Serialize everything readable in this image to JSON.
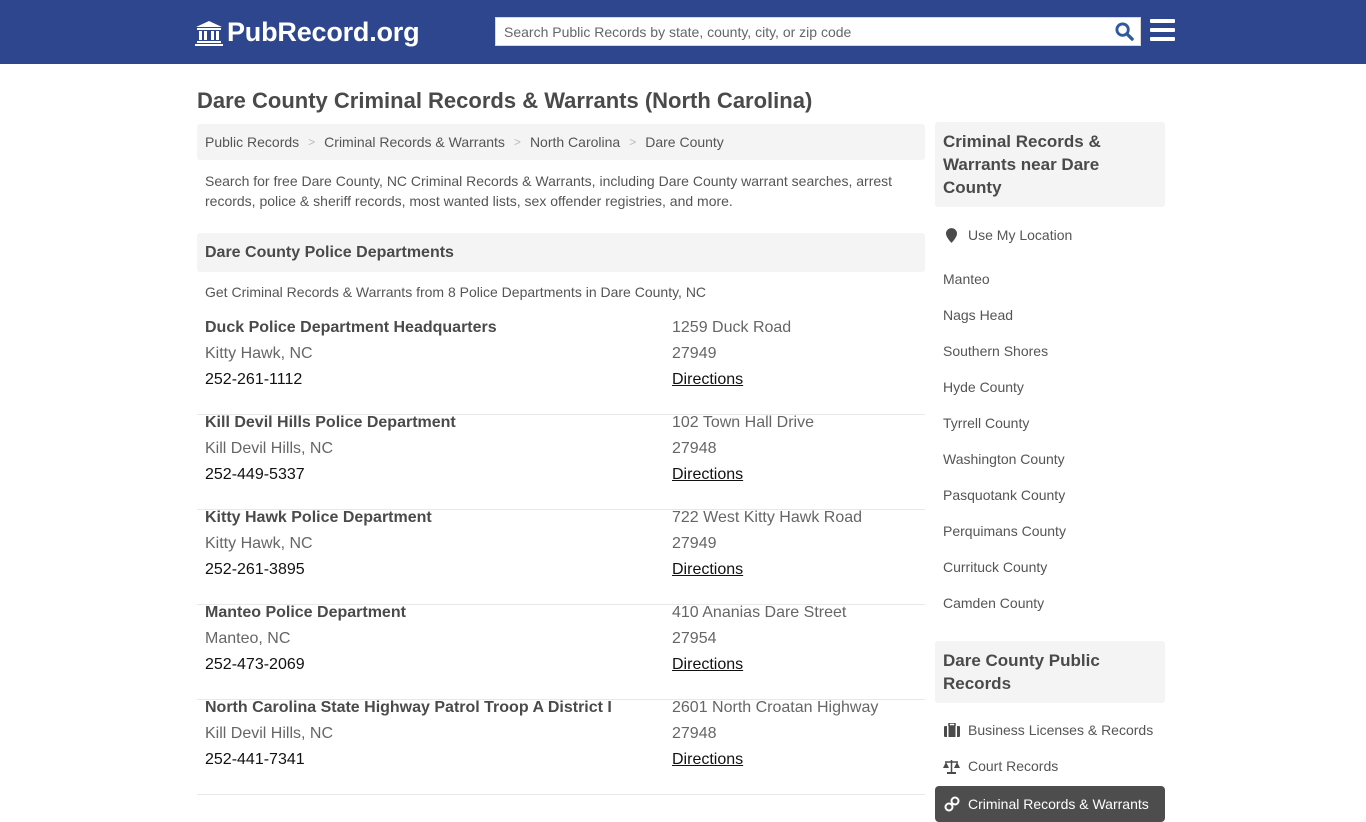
{
  "header": {
    "logo_text": "PubRecord.org",
    "search_placeholder": "Search Public Records by state, county, city, or zip code",
    "brand_color": "#2e468d"
  },
  "page": {
    "title": "Dare County Criminal Records & Warrants (North Carolina)"
  },
  "breadcrumb": [
    {
      "label": "Public Records"
    },
    {
      "label": "Criminal Records & Warrants"
    },
    {
      "label": "North Carolina"
    },
    {
      "label": "Dare County"
    }
  ],
  "intro": "Search for free Dare County, NC Criminal Records & Warrants, including Dare County warrant searches, arrest records, police & sheriff records, most wanted lists, sex offender registries, and more.",
  "police_section": {
    "heading": "Dare County Police Departments",
    "subheading": "Get Criminal Records & Warrants from 8 Police Departments in Dare County, NC",
    "departments": [
      {
        "name": "Duck Police Department Headquarters",
        "city": "Kitty Hawk, NC",
        "phone": "252-261-1112",
        "address": "1259 Duck Road",
        "zip": "27949",
        "directions": "Directions"
      },
      {
        "name": "Kill Devil Hills Police Department",
        "city": "Kill Devil Hills, NC",
        "phone": "252-449-5337",
        "address": "102 Town Hall Drive",
        "zip": "27948",
        "directions": "Directions"
      },
      {
        "name": "Kitty Hawk Police Department",
        "city": "Kitty Hawk, NC",
        "phone": "252-261-3895",
        "address": "722 West Kitty Hawk Road",
        "zip": "27949",
        "directions": "Directions"
      },
      {
        "name": "Manteo Police Department",
        "city": "Manteo, NC",
        "phone": "252-473-2069",
        "address": "410 Ananias Dare Street",
        "zip": "27954",
        "directions": "Directions"
      },
      {
        "name": "North Carolina State Highway Patrol Troop A District I",
        "city": "Kill Devil Hills, NC",
        "phone": "252-441-7341",
        "address": "2601 North Croatan Highway",
        "zip": "27948",
        "directions": "Directions"
      }
    ]
  },
  "sidebar": {
    "nearby_heading": "Criminal Records & Warrants near Dare County",
    "use_location": "Use My Location",
    "nearby": [
      "Manteo",
      "Nags Head",
      "Southern Shores",
      "Hyde County",
      "Tyrrell County",
      "Washington County",
      "Pasquotank County",
      "Perquimans County",
      "Currituck County",
      "Camden County"
    ],
    "records_heading": "Dare County Public Records",
    "records": [
      {
        "label": "Business Licenses & Records",
        "icon": "briefcase-icon"
      },
      {
        "label": "Court Records",
        "icon": "scale-icon"
      },
      {
        "label": "Criminal Records & Warrants",
        "icon": "handcuffs-icon",
        "active": true
      }
    ]
  }
}
